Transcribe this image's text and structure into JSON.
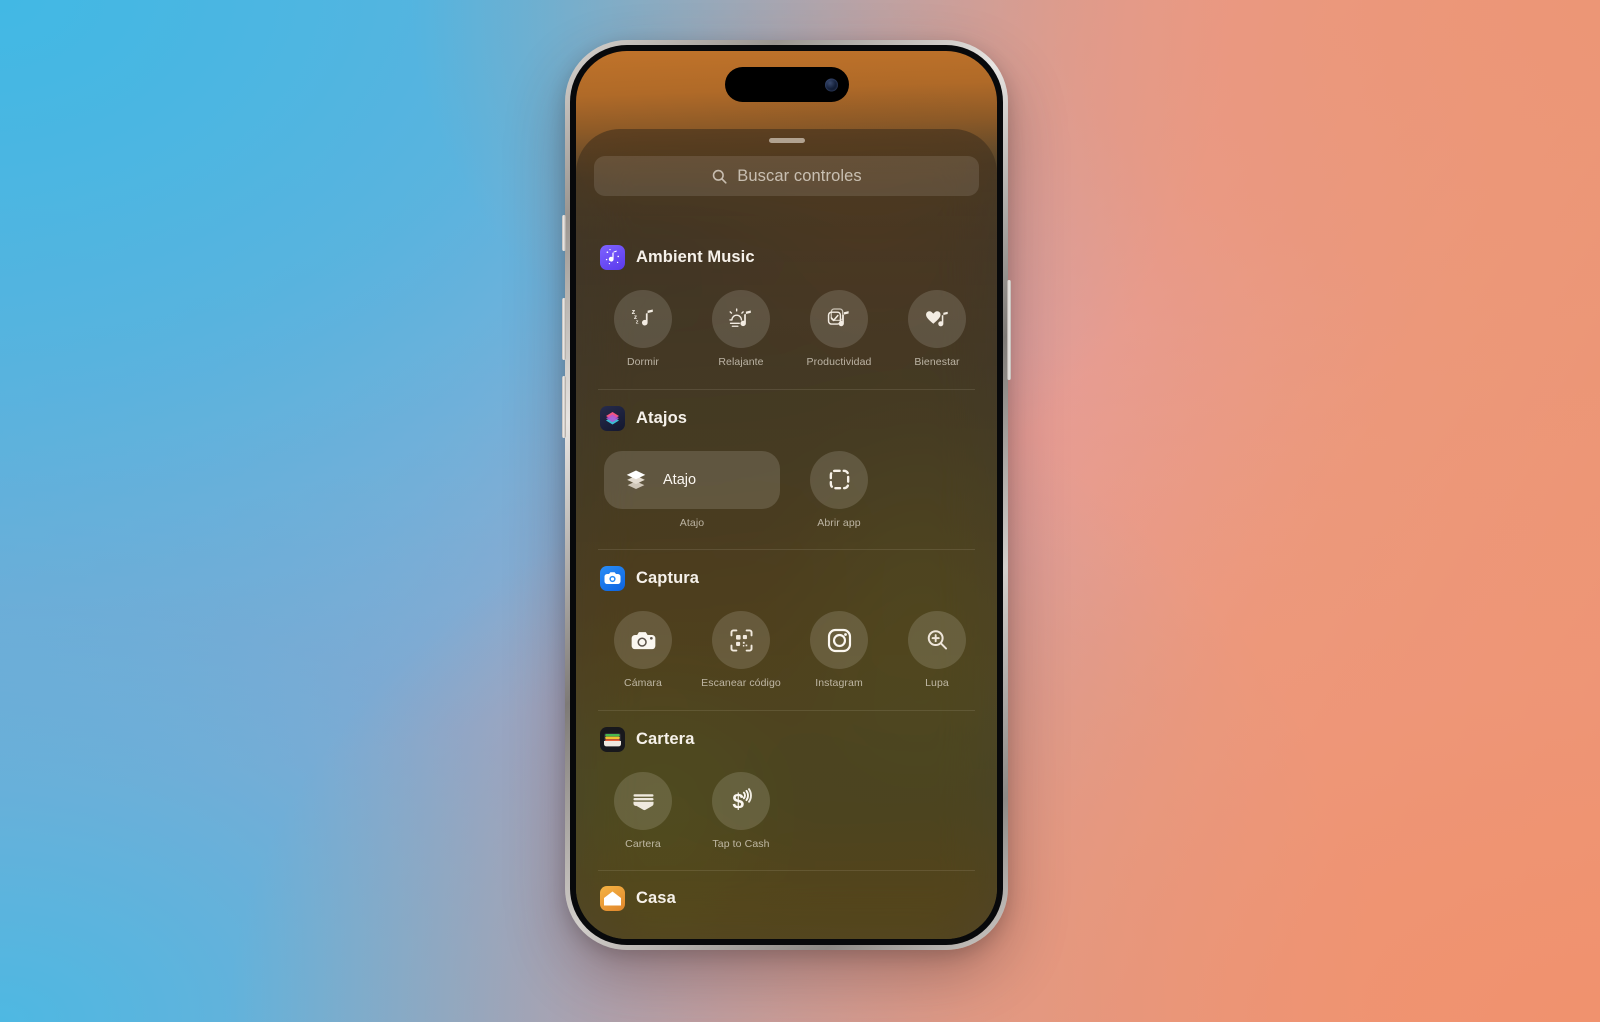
{
  "device": {
    "name": "iphone-pro",
    "buttons": [
      "action-button",
      "volume-up-button",
      "volume-down-button",
      "power-button"
    ]
  },
  "sheet": {
    "name": "controls-gallery-sheet",
    "grabber": "drag-handle"
  },
  "search": {
    "placeholder": "Buscar controles",
    "value": "",
    "icon": "search-icon"
  },
  "sections": [
    {
      "id": "ambient-music",
      "title": "Ambient Music",
      "app_icon": "ambient-music-app-icon",
      "icon_color": "#6b4ff0",
      "layout": "circles",
      "controls": [
        {
          "label": "Dormir",
          "icon": "sleep-music-icon"
        },
        {
          "label": "Relajante",
          "icon": "sunset-music-icon"
        },
        {
          "label": "Productividad",
          "icon": "checklist-music-icon"
        },
        {
          "label": "Bienestar",
          "icon": "heart-music-icon"
        }
      ]
    },
    {
      "id": "atajos",
      "title": "Atajos",
      "app_icon": "shortcuts-app-icon",
      "icon_color": "#1b2240",
      "layout": "mixed",
      "controls": [
        {
          "label": "Atajo",
          "inline_label": "Atajo",
          "icon": "shortcut-stack-icon",
          "shape": "pill"
        },
        {
          "label": "Abrir app",
          "icon": "open-app-dashed-square-icon",
          "shape": "circle"
        }
      ]
    },
    {
      "id": "captura",
      "title": "Captura",
      "app_icon": "camera-app-icon",
      "icon_color": "#1478f0",
      "layout": "circles",
      "controls": [
        {
          "label": "Cámara",
          "icon": "camera-icon"
        },
        {
          "label": "Escanear código",
          "icon": "qr-scan-icon"
        },
        {
          "label": "Instagram",
          "icon": "instagram-icon"
        },
        {
          "label": "Lupa",
          "icon": "magnifier-plus-icon"
        }
      ]
    },
    {
      "id": "cartera",
      "title": "Cartera",
      "app_icon": "wallet-app-icon",
      "icon_color": "#16161a",
      "layout": "circles",
      "controls": [
        {
          "label": "Cartera",
          "icon": "wallet-icon"
        },
        {
          "label": "Tap to Cash",
          "icon": "tap-to-cash-icon"
        }
      ]
    },
    {
      "id": "casa",
      "title": "Casa",
      "app_icon": "home-app-icon",
      "icon_color": "#e8a33d",
      "layout": "cut-off",
      "controls": []
    }
  ],
  "colors": {
    "accent_blue": "#1478f0",
    "accent_purple": "#6b4ff0",
    "sheet_text": "#f6f1ea",
    "label_text": "rgba(232,224,212,0.72)",
    "wallpaper_top": "#c0732a",
    "background_left": "#44b8e4",
    "background_right": "#e89478"
  }
}
